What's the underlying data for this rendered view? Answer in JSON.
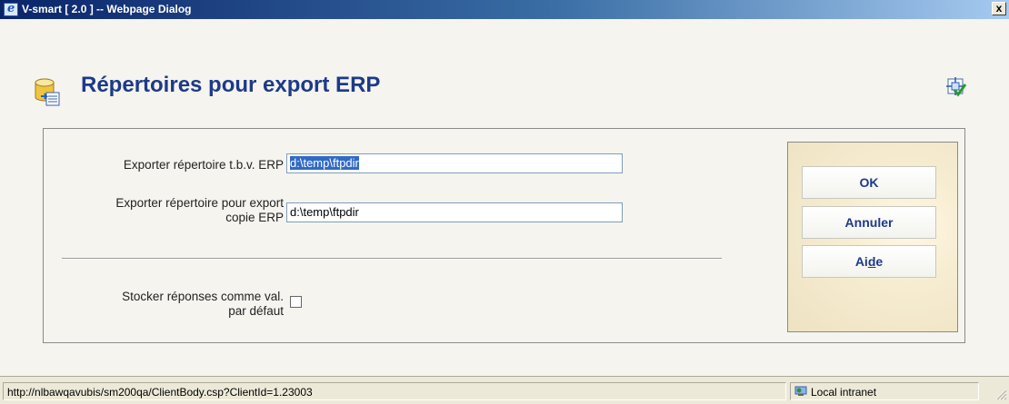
{
  "window": {
    "title": "V-smart [ 2.0 ] -- Webpage Dialog",
    "close_label": "x"
  },
  "header": {
    "title": "Répertoires pour export ERP"
  },
  "form": {
    "field1": {
      "label": "Exporter répertoire t.b.v. ERP",
      "value": "d:\\temp\\ftpdir"
    },
    "field2": {
      "label_line1": "Exporter répertoire pour export",
      "label_line2": "copie ERP",
      "value": "d:\\temp\\ftpdir"
    },
    "checkbox": {
      "label_line1": "Stocker réponses comme val.",
      "label_line2": "par défaut",
      "checked": false
    }
  },
  "buttons": {
    "ok": "OK",
    "cancel": "Annuler",
    "help_pre": "Ai",
    "help_underlined": "d",
    "help_post": "e"
  },
  "statusbar": {
    "url": "http://nlbawqavubis/sm200qa/ClientBody.csp?ClientId=1.23003",
    "zone": "Local intranet"
  },
  "icons": {
    "app": "ie-icon",
    "header": "database-export-icon",
    "shortcut": "shortcut-check-icon",
    "zone": "intranet-icon"
  }
}
